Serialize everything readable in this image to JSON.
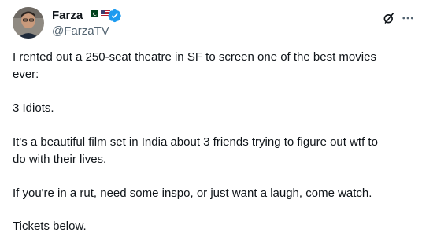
{
  "tweet": {
    "author": {
      "display_name": "Farza",
      "handle": "@FarzaTV",
      "flags": [
        "pakistan-flag",
        "us-flag"
      ],
      "verified": true
    },
    "actions": {
      "grok_icon": "grok-icon",
      "more_icon": "more-icon"
    },
    "paragraphs": [
      "I rented out a 250-seat theatre in SF to screen one of the best movies\never:",
      "3 Idiots.",
      "It's a beautiful film set in India about 3 friends trying to figure out wtf to\ndo with their lives.",
      "If you're in a rut, need some inspo, or just want a laugh, come watch.",
      "Tickets below."
    ]
  },
  "colors": {
    "text": "#0f1419",
    "secondary": "#536471",
    "verified": "#1d9bf0"
  }
}
